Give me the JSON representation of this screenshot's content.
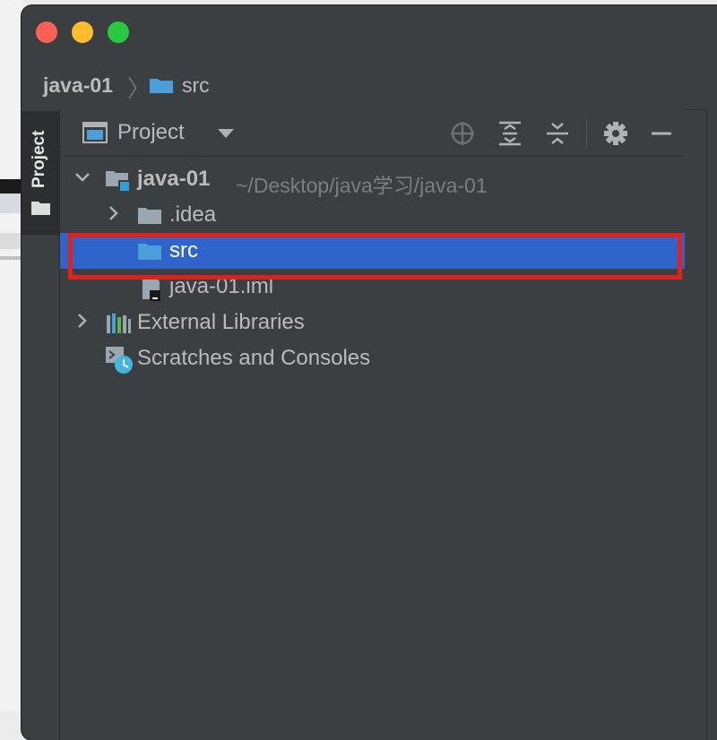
{
  "window": {
    "breadcrumb": {
      "project": "java-01",
      "separator": "〉",
      "folder": "src"
    }
  },
  "toolstrip": {
    "project_label": "Project"
  },
  "panel": {
    "title": "Project",
    "tools": [
      "locate-icon",
      "expand-all-icon",
      "collapse-all-icon",
      "gear-icon",
      "minimize-icon"
    ]
  },
  "tree": {
    "root": {
      "name": "java-01",
      "path": "~/Desktop/java学习/java-01"
    },
    "idea": ".idea",
    "src": "src",
    "iml": "java-01.iml",
    "external": "External Libraries",
    "scratches": "Scratches and Consoles"
  },
  "colors": {
    "background": "#3c3f41",
    "selection": "#2f65ca",
    "highlight_border": "#e0221e",
    "folder_blue": "#4a9fd8",
    "folder_gray": "#9aa7b0"
  }
}
